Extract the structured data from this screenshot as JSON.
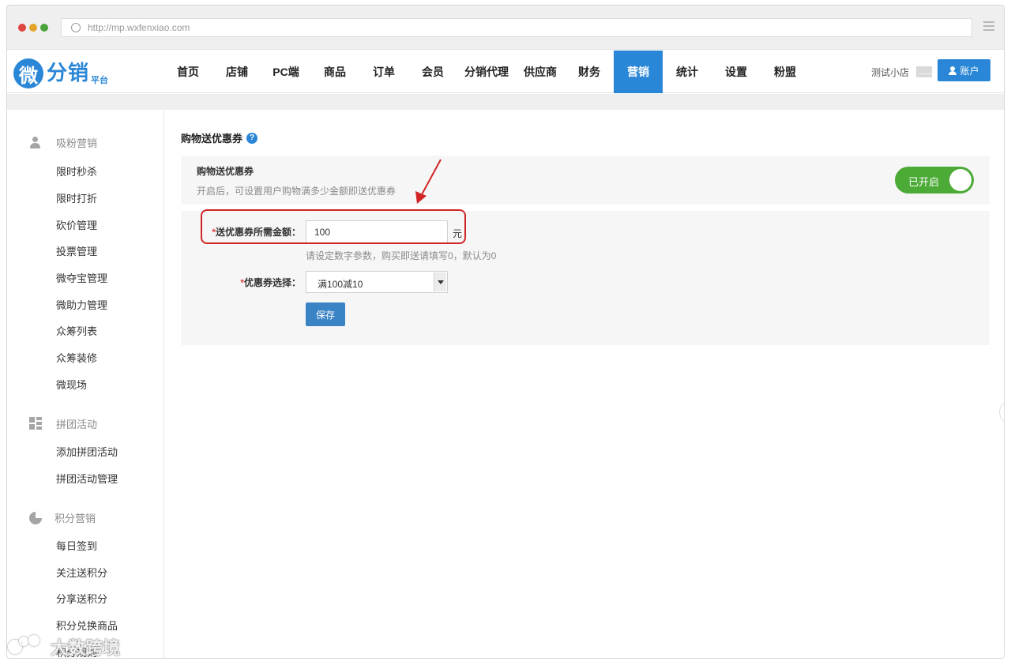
{
  "browser": {
    "url": "http://mp.wxfenxiao.com"
  },
  "brand": {
    "logo_mark": "微",
    "logo_text": "分销",
    "logo_sub": "平台"
  },
  "nav": {
    "items": [
      {
        "label": "首页"
      },
      {
        "label": "店铺"
      },
      {
        "label": "PC端"
      },
      {
        "label": "商品"
      },
      {
        "label": "订单"
      },
      {
        "label": "会员"
      },
      {
        "label": "分销代理"
      },
      {
        "label": "供应商"
      },
      {
        "label": "财务"
      },
      {
        "label": "营销",
        "active": true
      },
      {
        "label": "统计"
      },
      {
        "label": "设置"
      },
      {
        "label": "粉盟"
      }
    ],
    "store_name": "测试小店",
    "account_label": "账户"
  },
  "sidebar": {
    "groups": [
      {
        "title": "吸粉营销",
        "icon": "people-icon",
        "items": [
          "限时秒杀",
          "限时打折",
          "砍价管理",
          "投票管理",
          "微夺宝管理",
          "微助力管理",
          "众筹列表",
          "众筹装修",
          "微现场"
        ]
      },
      {
        "title": "拼团活动",
        "icon": "grid-icon",
        "items": [
          "添加拼团活动",
          "拼团活动管理"
        ]
      },
      {
        "title": "积分营销",
        "icon": "pie-chart-icon",
        "items": [
          "每日签到",
          "关注送积分",
          "分享送积分",
          "积分兑换商品",
          "积分规则"
        ]
      }
    ]
  },
  "main": {
    "page_title": "购物送优惠券",
    "panel": {
      "heading": "购物送优惠券",
      "description": "开启后，可设置用户购物满多少金额即送优惠券",
      "toggle_label": "已开启",
      "toggle_on": true
    },
    "form": {
      "amount_label": "*送优惠券所需金额：",
      "amount_value": "100",
      "amount_unit": "元",
      "amount_hint": "请设定数字参数，购买即送请填写0，默认为0",
      "coupon_label": "*优惠券选择：",
      "coupon_selected": "满100减10",
      "save_label": "保存"
    }
  },
  "watermark": {
    "text": "大数跨境"
  },
  "colors": {
    "primary": "#2a86d6",
    "toggle_on": "#4caa36",
    "annotation": "#d12525"
  }
}
